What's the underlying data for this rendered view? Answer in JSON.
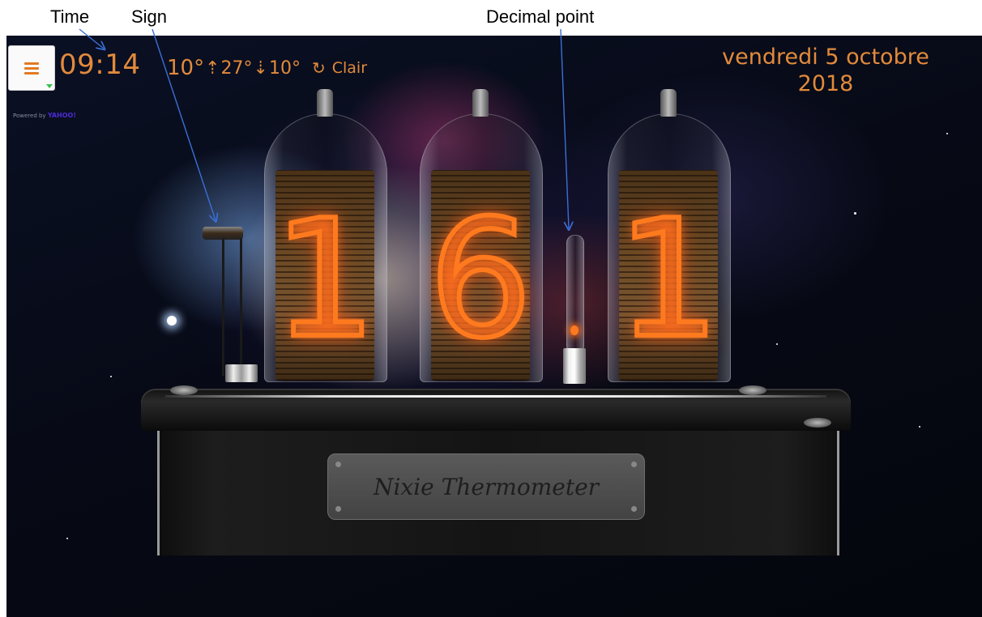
{
  "annotations": {
    "time": "Time",
    "sign": "Sign",
    "decimal_point": "Decimal point"
  },
  "header": {
    "time": "09:14",
    "temp_current": "10°",
    "temp_high": "27°",
    "temp_low": "10°",
    "condition": "Clair",
    "condition_icon": "moon-crescent-icon",
    "powered_by_prefix": "Powered by",
    "powered_by_brand": "YAHOO!"
  },
  "date": {
    "line1": "vendredi 5 octobre",
    "line2": "2018"
  },
  "tubes": {
    "digit1": "1",
    "digit2": "6",
    "digit3": "1"
  },
  "device": {
    "nameplate": "Nixie Thermometer"
  },
  "colors": {
    "accent": "#e28a3b",
    "nixie_glow": "#ff7a1e",
    "menu_bars": "#e27a22"
  }
}
